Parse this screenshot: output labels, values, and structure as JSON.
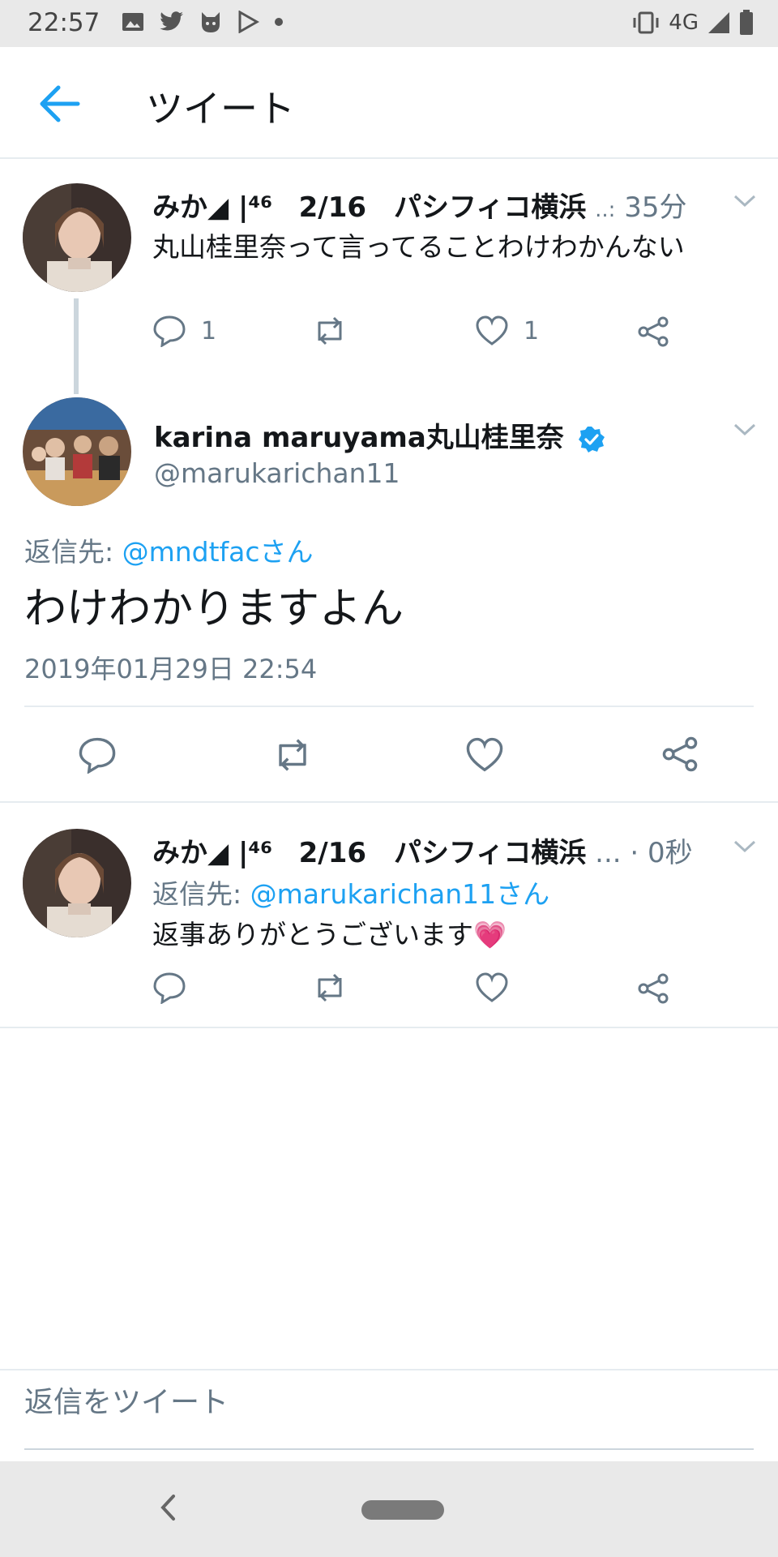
{
  "status_bar": {
    "time": "22:57",
    "left_icons": [
      "image-icon",
      "twitter-icon",
      "cat-app-icon",
      "play-store-icon",
      "dot-icon"
    ],
    "network": "4G",
    "right_icons": [
      "vibrate-icon",
      "signal-icon",
      "battery-icon"
    ]
  },
  "app_bar": {
    "back_icon": "arrow-left-icon",
    "title": "ツイート"
  },
  "colors": {
    "accent": "#1da1f2",
    "muted_text": "#657786",
    "divider": "#e6ecf0",
    "status_bar_bg": "#e9e9e9"
  },
  "tweets": [
    {
      "display_name": "みか◢ |⁴⁶",
      "event": "2/16　パシフィコ横浜",
      "ellipsis": "..:",
      "time": "35分",
      "text": "丸山桂里奈って言ってることわけわかんない",
      "reply_count": "1",
      "like_count": "1"
    },
    {
      "display_name": "karina maruyama丸山桂里奈",
      "handle": "@marukarichan11",
      "reply_to_label": "返信先: ",
      "reply_to_handle": "@mndtfacさん",
      "text": "わけわかりますよん",
      "timestamp": "2019年01月29日 22:54"
    },
    {
      "display_name": "みか◢ |⁴⁶",
      "event": "2/16　パシフィコ横浜",
      "ellipsis": "...",
      "time": "· 0秒",
      "reply_to_label": "返信先: ",
      "reply_to_handle": "@marukarichan11さん",
      "text": "返事ありがとうございます",
      "emoji": "💗"
    }
  ],
  "reply_input": {
    "placeholder": "返信をツイート"
  }
}
